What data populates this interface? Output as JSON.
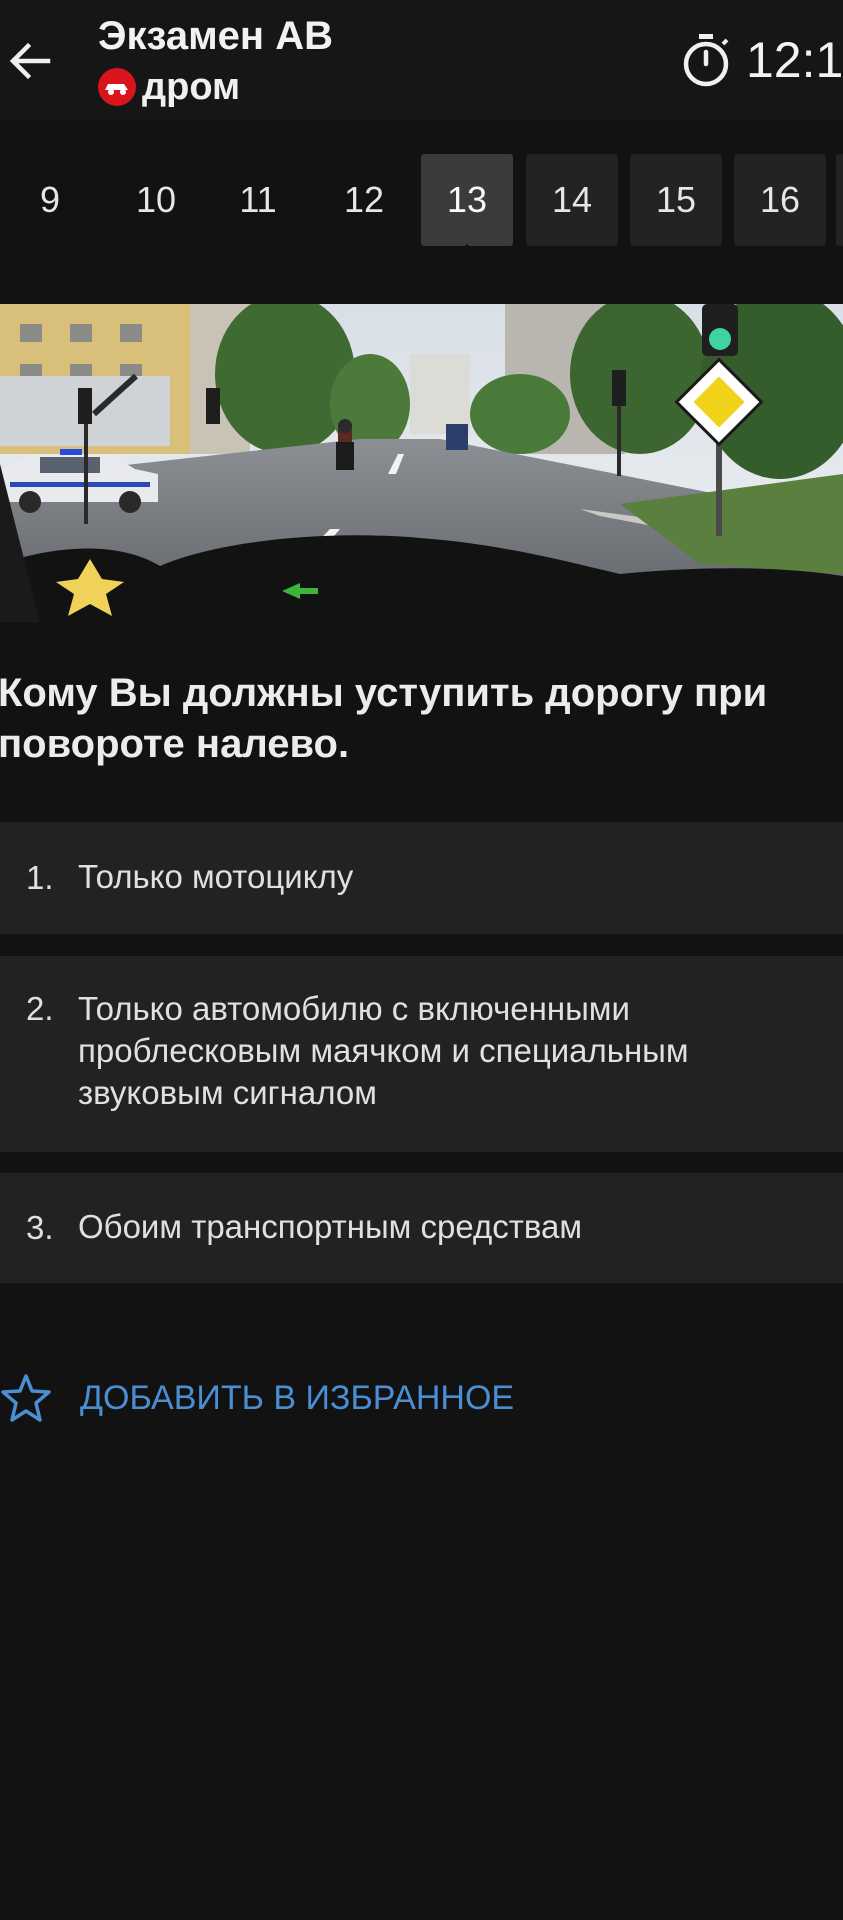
{
  "header": {
    "title": "Экзамен АВ",
    "brand": "дром",
    "timer": "12:1"
  },
  "tabs": [
    "9",
    "10",
    "11",
    "12",
    "13",
    "14",
    "15",
    "16"
  ],
  "active_tab": "13",
  "question": {
    "text": "Кому Вы должны уступить дорогу при повороте налево."
  },
  "answers": [
    {
      "num": "1.",
      "text": "Только мотоциклу"
    },
    {
      "num": "2.",
      "text": "Только автомобилю с включенными проблесковым маячком и специальным звуковым сигналом"
    },
    {
      "num": "3.",
      "text": "Обоим транспортным средствам"
    }
  ],
  "favorite": {
    "label": "ДОБАВИТЬ В ИЗБРАННОЕ"
  },
  "colors": {
    "background": "#121212",
    "answer_bg": "#222222",
    "link": "#4a8fd4",
    "brand": "#d8141c"
  }
}
